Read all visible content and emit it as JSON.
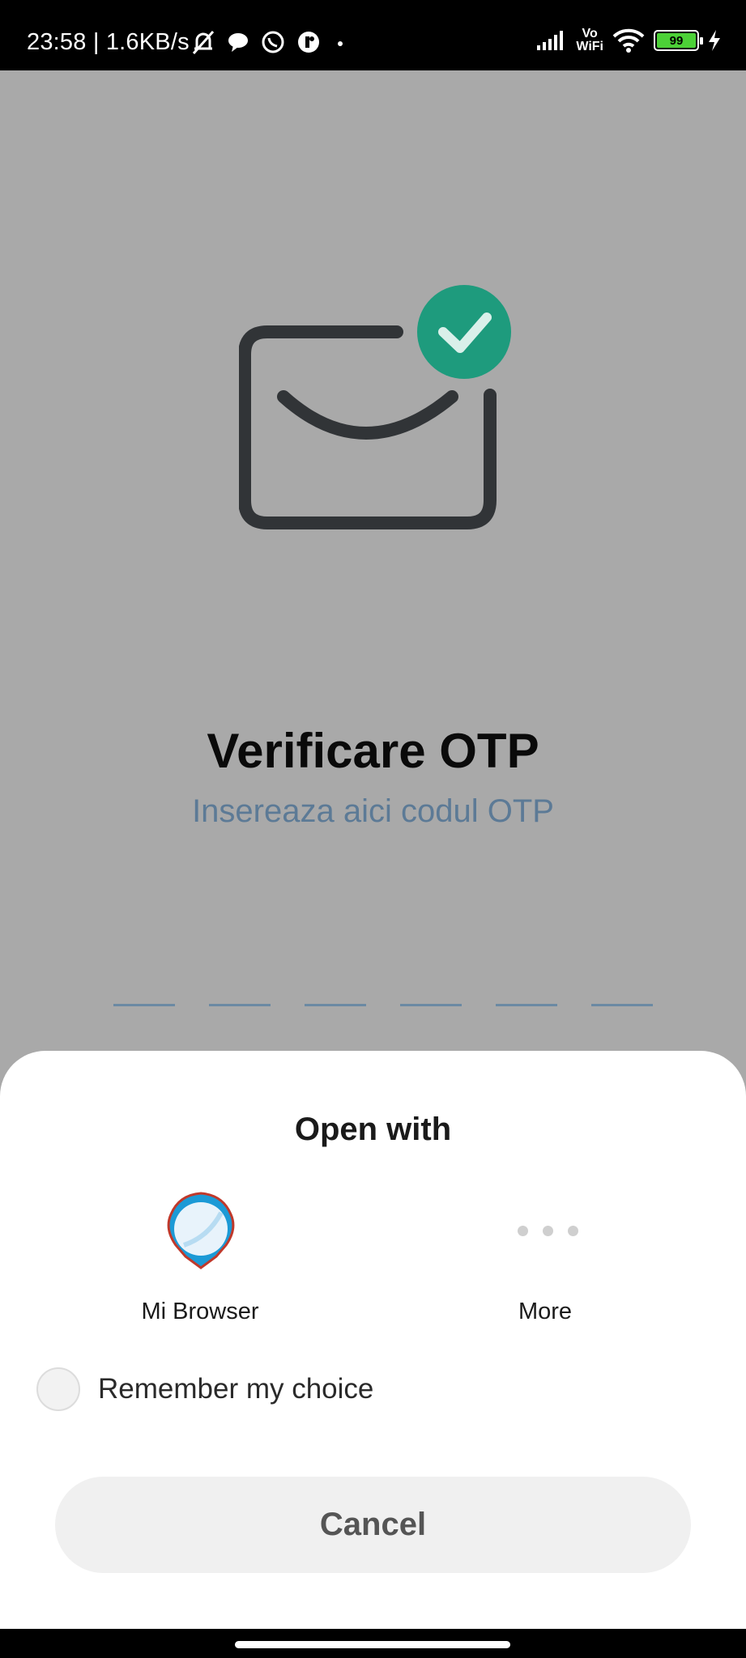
{
  "status_bar": {
    "time_speed": "23:58 | 1.6KB/s",
    "icons": [
      "mute-bell-icon",
      "chat-bubble-icon",
      "whatsapp-icon",
      "app-icon",
      "dot-icon"
    ],
    "vowifi_top": "Vo",
    "vowifi_bottom": "WiFi",
    "battery": "99"
  },
  "page": {
    "title": "Verificare OTP",
    "subtitle": "Insereaza aici codul OTP",
    "otp_slots": 6,
    "accent_color": "#1e9b7d"
  },
  "sheet": {
    "title": "Open with",
    "apps": [
      {
        "label": "Mi Browser",
        "icon": "mi-browser-icon"
      },
      {
        "label": "More",
        "icon": "more-dots-icon"
      }
    ],
    "remember_label": "Remember my choice",
    "cancel_label": "Cancel"
  }
}
